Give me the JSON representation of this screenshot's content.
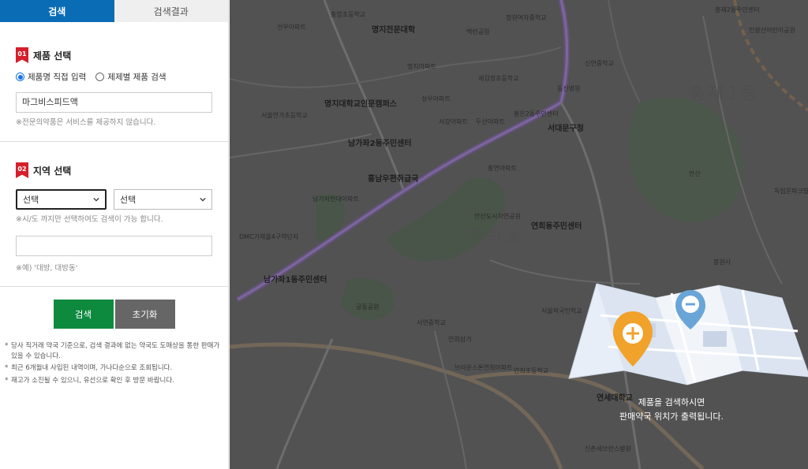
{
  "tabs": {
    "search": "검색",
    "results": "검색결과"
  },
  "product": {
    "num": "01",
    "title": "제품 선택",
    "radio_direct": "제품명 직접 입력",
    "radio_by_product": "제제별 제품 검색",
    "input_value": "마그비스피드액",
    "note": "※전문의약품은 서비스를 제공하지 않습니다."
  },
  "region": {
    "num": "02",
    "title": "지역 선택",
    "select1": "선택",
    "select2": "선택",
    "note1": "※시/도 까지만 선택하여도 검색이 가능 합니다.",
    "input_value": "",
    "note2": "※예) '대방, 대방동'"
  },
  "buttons": {
    "search": "검색",
    "reset": "초기화"
  },
  "notices": [
    "당사 직거래 약국 기준으로, 검색 결과에 없는 약국도 도매상을 통한 판매가 있을 수 있습니다.",
    "최근 6개월내 사입된 내역이며, 가나다순으로 조회됩니다.",
    "재고가 소진될 수 있으니, 유선으로 확인 후 방문 바랍니다."
  ],
  "map": {
    "labels": [
      "충암초등학교",
      "명지전문대학",
      "백련공원",
      "정원여자중학교",
      "흥제2동주민센터",
      "인왕산어린이공원",
      "명지아파트",
      "선우아파트",
      "세검정초등학교",
      "신연중학교",
      "서울연가초등학교",
      "명지대학교인문캠퍼스",
      "성우아파트",
      "서강아파트",
      "두산아파트",
      "홍은2동주민센터",
      "동신병원",
      "서대문구청",
      "홍제1동",
      "남가좌2동주민센터",
      "홍남우편취급국",
      "홍연아파트",
      "안산도시자연공원",
      "안산",
      "연희동주민센터",
      "독립문파크빌아파트",
      "DMC가재울4구역단지",
      "남가좌1동주민센터",
      "봉원사",
      "궁동공원",
      "서연중학교",
      "연희삼거",
      "브라운스톤연희아파트",
      "서울외국인학교",
      "연세대학교",
      "신촌세브란스병원",
      "연희초등학교",
      "남가좌현대아파트",
      "연희동"
    ],
    "overlay_line1": "제품을 검색하시면",
    "overlay_line2": "판매약국 위치가 출력됩니다."
  }
}
